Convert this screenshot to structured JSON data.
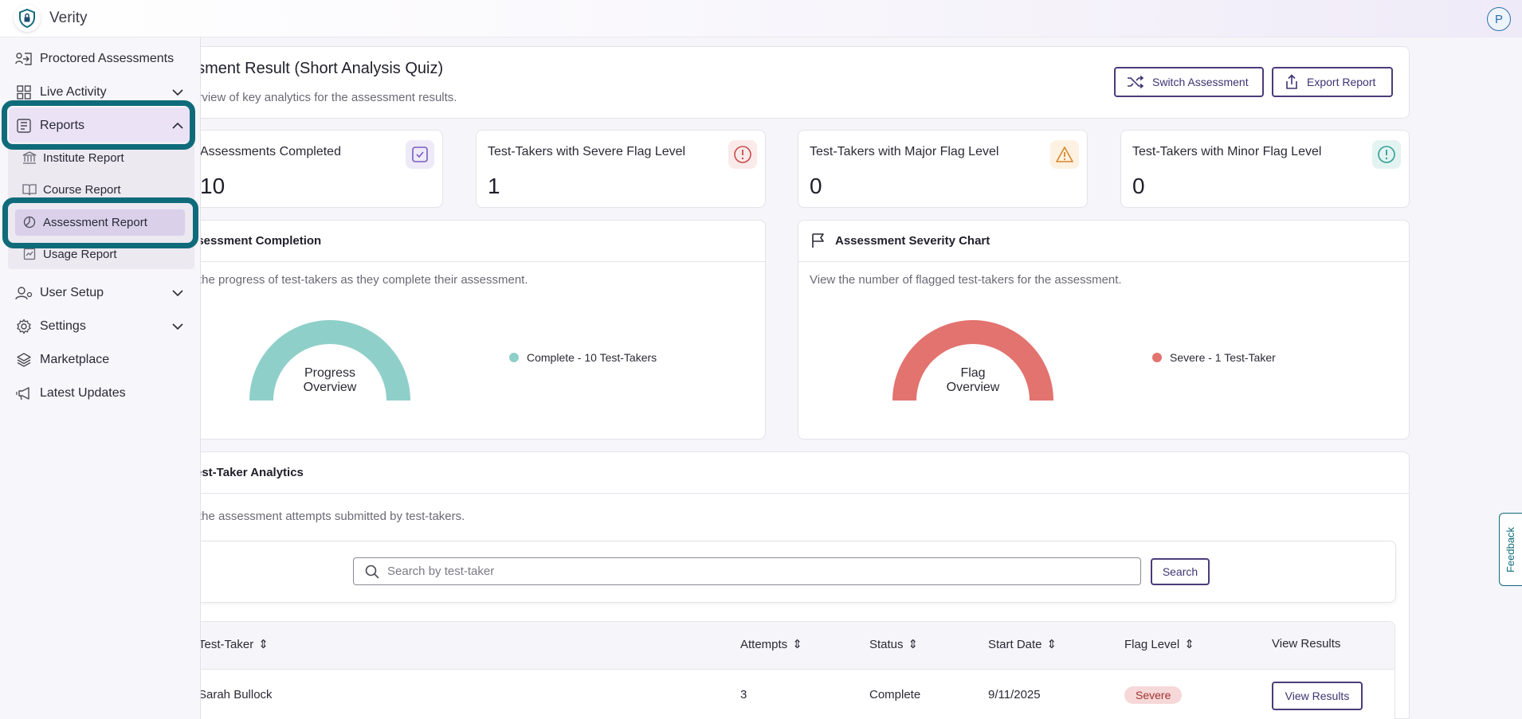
{
  "app": {
    "title": "Verity",
    "avatar_initial": "P"
  },
  "sidebar": {
    "items": [
      {
        "label": "Proctored Assessments",
        "icon": "proctor-icon"
      },
      {
        "label": "Live Activity",
        "icon": "grid-icon"
      },
      {
        "label": "Reports",
        "icon": "report-icon"
      },
      {
        "label": "User Setup",
        "icon": "user-setup-icon"
      },
      {
        "label": "Settings",
        "icon": "gear-icon"
      },
      {
        "label": "Marketplace",
        "icon": "layers-icon"
      },
      {
        "label": "Latest Updates",
        "icon": "megaphone-icon"
      }
    ],
    "report_subitems": [
      {
        "label": "Institute Report",
        "icon": "institution-icon"
      },
      {
        "label": "Course Report",
        "icon": "book-icon"
      },
      {
        "label": "Assessment Report",
        "icon": "pie-icon"
      },
      {
        "label": "Usage Report",
        "icon": "usage-icon"
      }
    ]
  },
  "header": {
    "title": "essment Result (Short Analysis Quiz)",
    "subtitle": "erview of key analytics for the assessment results.",
    "switch_label": "Switch Assessment",
    "export_label": "Export Report"
  },
  "stats": [
    {
      "label": "Assessments Completed",
      "value": "10",
      "color": "#7a5cc2"
    },
    {
      "label": "Test-Takers with Severe Flag Level",
      "value": "1",
      "color": "#c94a4a"
    },
    {
      "label": "Test-Takers with Major Flag Level",
      "value": "0",
      "color": "#d6872b"
    },
    {
      "label": "Test-Takers with Minor Flag Level",
      "value": "0",
      "color": "#2f9e95"
    }
  ],
  "completion": {
    "title": "ssessment Completion",
    "desc": "the progress of test-takers as they complete their assessment.",
    "gauge_line1": "Progress",
    "gauge_line2": "Overview",
    "legend": "Complete - 10 Test-Takers",
    "color": "#8fcfc9"
  },
  "severity": {
    "title": "Assessment Severity Chart",
    "desc": "View the number of flagged test-takers for the assessment.",
    "gauge_line1": "Flag",
    "gauge_line2": "Overview",
    "legend": "Severe - 1 Test-Taker",
    "color": "#e2736f"
  },
  "analytics": {
    "title": "est-Taker Analytics",
    "desc": "the assessment attempts submitted by test-takers.",
    "search_placeholder": "Search by test-taker",
    "search_btn": "Search"
  },
  "table": {
    "columns": [
      "Test-Taker",
      "Attempts",
      "Status",
      "Start Date",
      "Flag Level",
      "View Results"
    ],
    "rows": [
      {
        "name": "Sarah Bullock",
        "attempts": "3",
        "status": "Complete",
        "start": "9/11/2025",
        "flag": "Severe",
        "action": "View Results"
      }
    ]
  },
  "feedback": "Feedback"
}
